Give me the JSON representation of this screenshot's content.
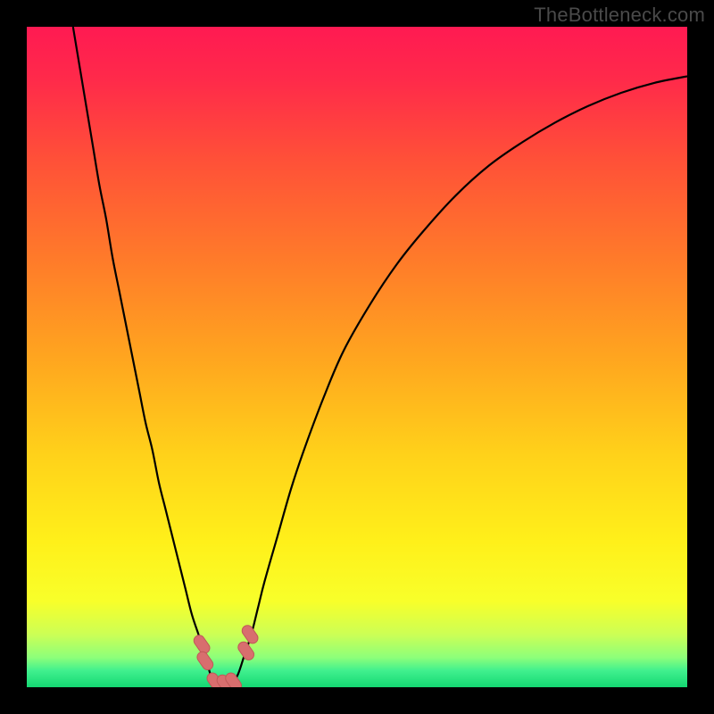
{
  "watermark": "TheBottleneck.com",
  "colors": {
    "frame": "#000000",
    "curve": "#000000",
    "marker_fill": "#d86e6e",
    "marker_stroke": "#c05858"
  },
  "chart_data": {
    "type": "line",
    "title": "",
    "xlabel": "",
    "ylabel": "",
    "xlim": [
      0,
      100
    ],
    "ylim": [
      0,
      100
    ],
    "grid": false,
    "legend": false,
    "background_gradient_stops": [
      {
        "offset": 0.0,
        "color": "#ff1a52"
      },
      {
        "offset": 0.08,
        "color": "#ff2a4a"
      },
      {
        "offset": 0.2,
        "color": "#ff5038"
      },
      {
        "offset": 0.35,
        "color": "#ff7a2a"
      },
      {
        "offset": 0.5,
        "color": "#ffa51f"
      },
      {
        "offset": 0.65,
        "color": "#ffd21a"
      },
      {
        "offset": 0.78,
        "color": "#fff01a"
      },
      {
        "offset": 0.87,
        "color": "#f8ff2a"
      },
      {
        "offset": 0.92,
        "color": "#ccff55"
      },
      {
        "offset": 0.955,
        "color": "#8dff7a"
      },
      {
        "offset": 0.975,
        "color": "#40f08e"
      },
      {
        "offset": 1.0,
        "color": "#14d872"
      }
    ],
    "series": [
      {
        "name": "left-branch",
        "x": [
          7,
          8,
          9,
          10,
          11,
          12,
          13,
          14,
          15,
          16,
          17,
          18,
          19,
          20,
          21,
          22,
          23,
          24,
          25,
          26,
          27,
          27.5,
          28,
          29
        ],
        "y": [
          100,
          94,
          88,
          82,
          76,
          71,
          65,
          60,
          55,
          50,
          45,
          40,
          36,
          31,
          27,
          23,
          19,
          15,
          11,
          8,
          5,
          3,
          1.5,
          0.2
        ]
      },
      {
        "name": "right-branch",
        "x": [
          31,
          32,
          33,
          34,
          35,
          36,
          38,
          40,
          42,
          45,
          48,
          52,
          56,
          60,
          65,
          70,
          75,
          80,
          85,
          90,
          95,
          100
        ],
        "y": [
          0.2,
          2,
          5,
          8,
          12,
          16,
          23,
          30,
          36,
          44,
          51,
          58,
          64,
          69,
          74.5,
          79,
          82.5,
          85.5,
          88,
          90,
          91.5,
          92.5
        ]
      }
    ],
    "markers": [
      {
        "x": 26.5,
        "y": 6.5
      },
      {
        "x": 27.0,
        "y": 4.0
      },
      {
        "x": 28.5,
        "y": 0.8
      },
      {
        "x": 30.0,
        "y": 0.5
      },
      {
        "x": 31.3,
        "y": 0.8
      },
      {
        "x": 33.2,
        "y": 5.5
      },
      {
        "x": 33.8,
        "y": 8.0
      }
    ]
  }
}
